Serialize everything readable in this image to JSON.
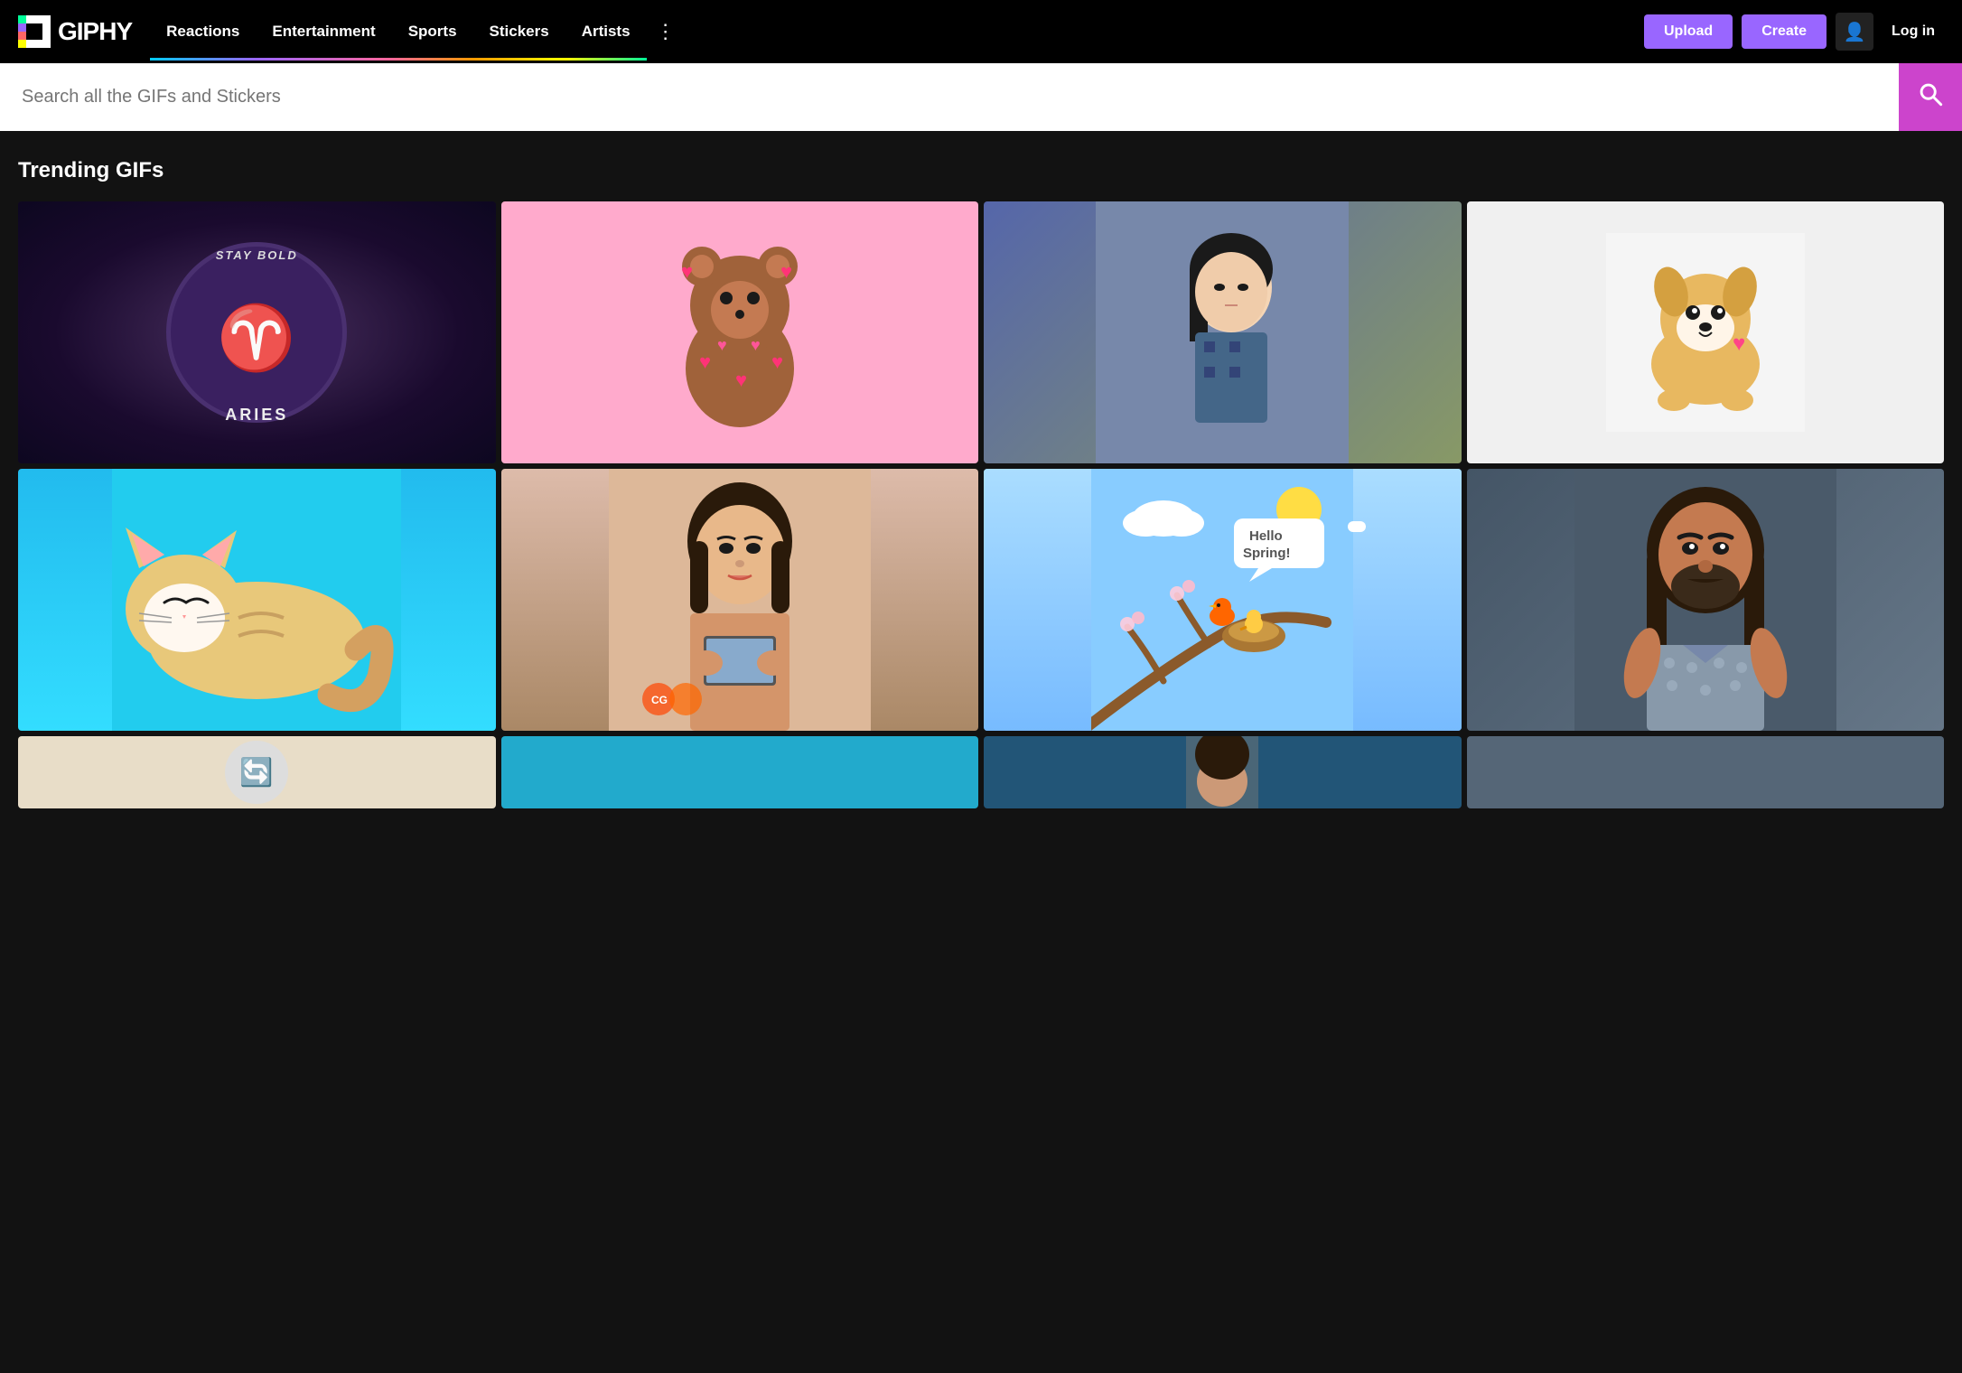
{
  "header": {
    "logo_text": "GIPHY",
    "nav_items": [
      {
        "label": "Reactions",
        "class": "reactions"
      },
      {
        "label": "Entertainment",
        "class": "entertainment"
      },
      {
        "label": "Sports",
        "class": "sports"
      },
      {
        "label": "Stickers",
        "class": "stickers"
      },
      {
        "label": "Artists",
        "class": "artists"
      }
    ],
    "more_icon": "⋮",
    "upload_label": "Upload",
    "create_label": "Create",
    "profile_icon": "👤",
    "login_label": "Log in"
  },
  "search": {
    "placeholder": "Search all the GIFs and Stickers",
    "icon": "🔍"
  },
  "main": {
    "section_title": "Trending GIFs",
    "gifs": [
      {
        "id": "aries",
        "alt": "Aries Stay Bold moon GIF",
        "row": 1
      },
      {
        "id": "bear",
        "alt": "Cute bear with hearts GIF",
        "row": 1
      },
      {
        "id": "girl",
        "alt": "Asian girl GIF",
        "row": 1
      },
      {
        "id": "corgi",
        "alt": "Cartoon corgi dog GIF",
        "row": 1
      },
      {
        "id": "cat",
        "alt": "Sleeping cat on cyan background GIF",
        "row": 2
      },
      {
        "id": "kimk",
        "alt": "Woman holding phone GIF",
        "row": 2
      },
      {
        "id": "spring",
        "alt": "Hello Spring bird GIF",
        "row": 2
      },
      {
        "id": "jason",
        "alt": "Jason Momoa GIF",
        "row": 2
      }
    ]
  },
  "colors": {
    "background": "#121212",
    "header_bg": "#000000",
    "accent_purple": "#9966ff",
    "search_icon_bg": "#cc44cc",
    "nav_gradient_start": "#00ccff"
  }
}
